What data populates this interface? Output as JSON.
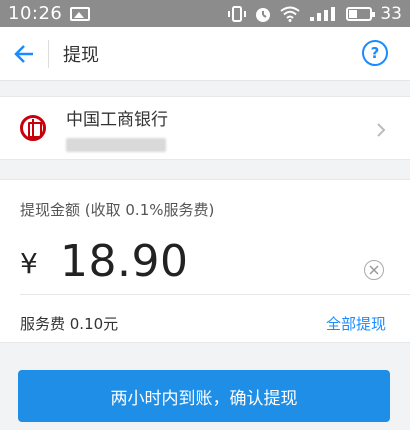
{
  "status_bar": {
    "time": "10:26",
    "battery_text": "33",
    "battery_level": 0.33,
    "icons": [
      "image-icon",
      "vibrate-icon",
      "alarm-icon",
      "wifi-icon",
      "signal-icon",
      "battery-icon"
    ]
  },
  "header": {
    "title": "提现",
    "back_icon": "back-arrow-icon",
    "help_label": "?"
  },
  "bank": {
    "name": "中国工商银行",
    "logo_icon": "icbc-logo",
    "account": ""
  },
  "amount": {
    "label": "提现金额 (收取 0.1%服务费)",
    "currency": "¥",
    "value": "18.90",
    "clear_icon": "clear-icon"
  },
  "fee": {
    "text": "服务费 0.10元",
    "withdraw_all_label": "全部提现"
  },
  "confirm": {
    "label": "两小时内到账，确认提现"
  },
  "colors": {
    "accent": "#1a8cff",
    "button": "#1e8ee6",
    "status_bar": "#8c8c8c",
    "bank_red": "#c7000b"
  }
}
